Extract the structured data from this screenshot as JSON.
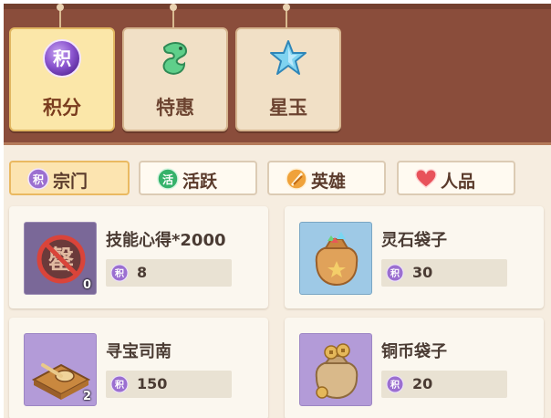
{
  "tabs": [
    {
      "label": "积分",
      "icon": "points-orb-icon",
      "active": true
    },
    {
      "label": "特惠",
      "icon": "jade-dragon-icon",
      "active": false
    },
    {
      "label": "星玉",
      "icon": "star-jade-icon",
      "active": false
    }
  ],
  "tab_icon_text": "积",
  "filters": [
    {
      "label": "宗门",
      "icon": "points-coin-icon",
      "icon_text": "积",
      "active": true
    },
    {
      "label": "活跃",
      "icon": "activity-badge-icon",
      "icon_text": "活",
      "active": false
    },
    {
      "label": "英雄",
      "icon": "hero-blades-icon",
      "active": false
    },
    {
      "label": "人品",
      "icon": "heart-icon",
      "active": false
    }
  ],
  "items": [
    {
      "name": "技能心得*2000",
      "price": "8",
      "count": "0",
      "icon": "forbidden-scroll-icon",
      "icon_text": "罄"
    },
    {
      "name": "灵石袋子",
      "price": "30",
      "count": "",
      "icon": "spirit-stone-bag-icon"
    },
    {
      "name": "寻宝司南",
      "price": "150",
      "count": "2",
      "icon": "compass-spoon-icon"
    },
    {
      "name": "铜币袋子",
      "price": "20",
      "count": "",
      "icon": "copper-coin-bag-icon"
    }
  ],
  "currency_icon_text": "积",
  "colors": {
    "header_brown": "#8a4d3b",
    "active_tab": "#fbe7a9",
    "panel_bg": "#f6ede0",
    "price_coin": "#9b6fd0"
  }
}
